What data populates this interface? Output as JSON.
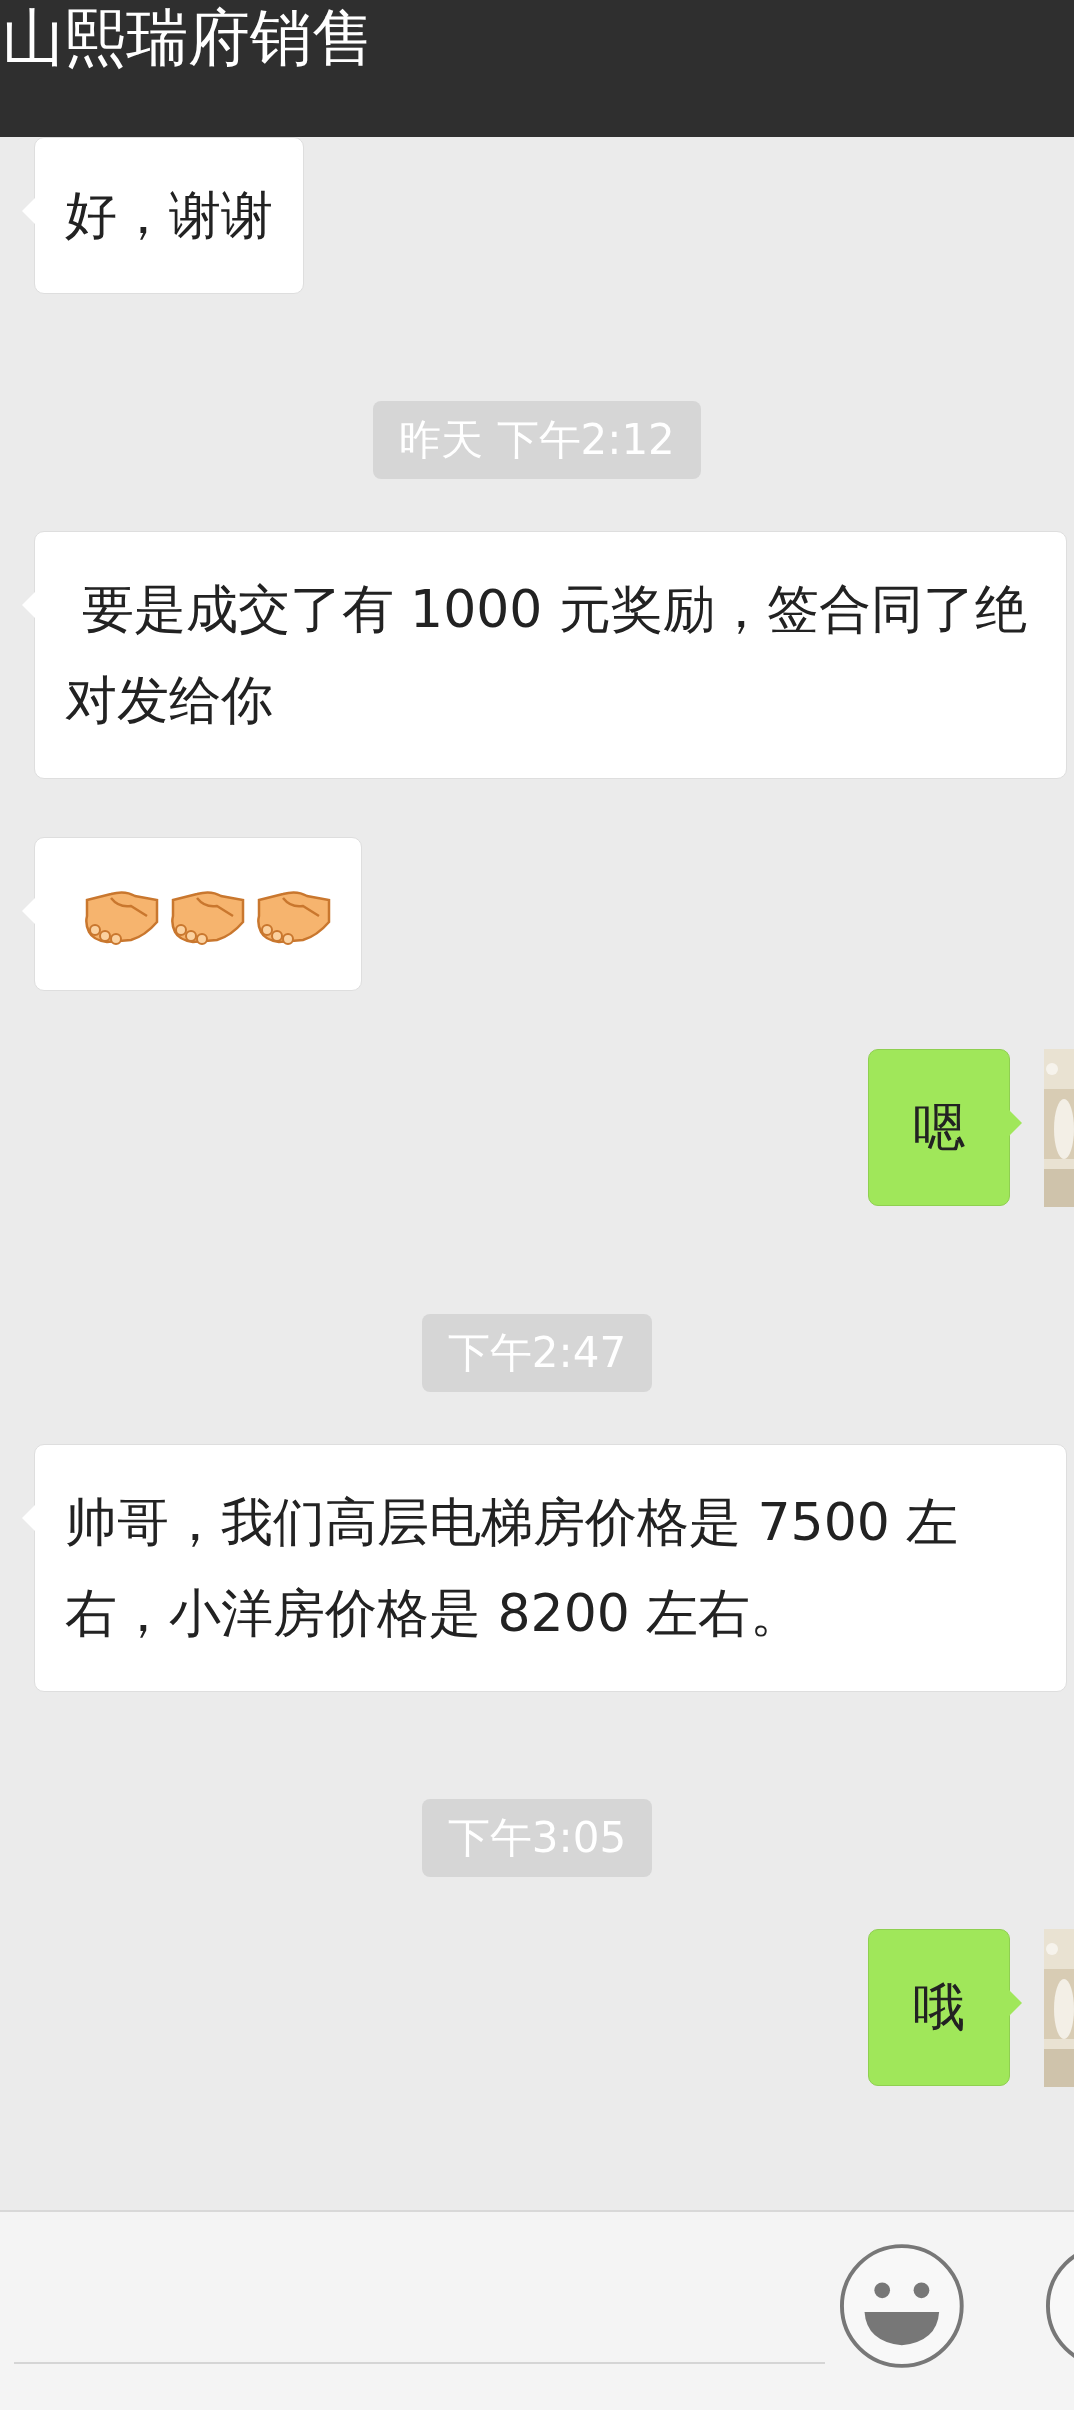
{
  "header": {
    "title": "山熙瑞府销售"
  },
  "messages": [
    {
      "kind": "text",
      "outgoing": false,
      "text": "好，谢谢"
    },
    {
      "kind": "time",
      "text": "昨天 下午2:12"
    },
    {
      "kind": "text",
      "outgoing": false,
      "text": " 要是成交了有 1000 元奖励，签合同了绝对发给你"
    },
    {
      "kind": "emoji",
      "outgoing": false,
      "icons": [
        {
          "kind": "handshake"
        },
        {
          "kind": "handshake"
        },
        {
          "kind": "handshake"
        }
      ]
    },
    {
      "kind": "text",
      "outgoing": true,
      "text": "嗯"
    },
    {
      "kind": "time",
      "text": "下午2:47"
    },
    {
      "kind": "text",
      "outgoing": false,
      "text": "帅哥，我们高层电梯房价格是 7500 左右，小洋房价格是 8200 左右。"
    },
    {
      "kind": "time",
      "text": "下午3:05"
    },
    {
      "kind": "text",
      "outgoing": true,
      "text": "哦"
    }
  ],
  "input_bar": {
    "kind": "text"
  }
}
